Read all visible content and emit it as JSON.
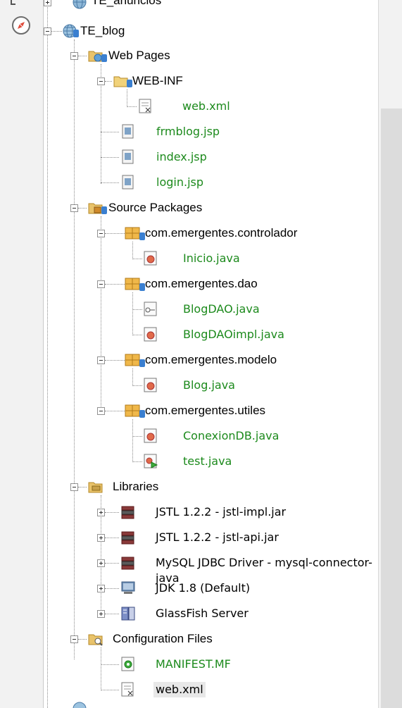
{
  "tree": {
    "top_partial": {
      "label": "TE_anuncios"
    },
    "project": {
      "label": "TE_blog"
    },
    "web_pages": {
      "label": "Web Pages",
      "web_inf": {
        "label": "WEB-INF",
        "files": [
          "web.xml"
        ]
      },
      "files": [
        "frmblog.jsp",
        "index.jsp",
        "login.jsp"
      ]
    },
    "source_packages": {
      "label": "Source Packages",
      "packages": [
        {
          "name": "com.emergentes.controlador",
          "files": [
            "Inicio.java"
          ]
        },
        {
          "name": "com.emergentes.dao",
          "files": [
            "BlogDAO.java",
            "BlogDAOimpl.java"
          ]
        },
        {
          "name": "com.emergentes.modelo",
          "files": [
            "Blog.java"
          ]
        },
        {
          "name": "com.emergentes.utiles",
          "files": [
            "ConexionDB.java",
            "test.java"
          ]
        }
      ]
    },
    "libraries": {
      "label": "Libraries",
      "items": [
        "JSTL 1.2.2 - jstl-impl.jar",
        "JSTL 1.2.2 - jstl-api.jar",
        "MySQL JDBC Driver - mysql-connector-java",
        "JDK 1.8 (Default)",
        "GlassFish Server"
      ]
    },
    "configuration_files": {
      "label": "Configuration Files",
      "files": [
        "MANIFEST.MF",
        "web.xml"
      ]
    }
  },
  "colors": {
    "file_green": "#1c8a1c",
    "selection": "#e8e8e8"
  },
  "icons": {
    "project": "globe-icon",
    "folder": "folder-icon",
    "package": "package-icon",
    "java": "java-class-icon",
    "interface": "java-interface-icon",
    "main": "java-main-class-icon",
    "jsp": "jsp-file-icon",
    "xml": "xml-file-icon",
    "jar": "jar-library-icon",
    "jdk": "jdk-icon",
    "server": "server-icon",
    "manifest": "manifest-icon"
  }
}
